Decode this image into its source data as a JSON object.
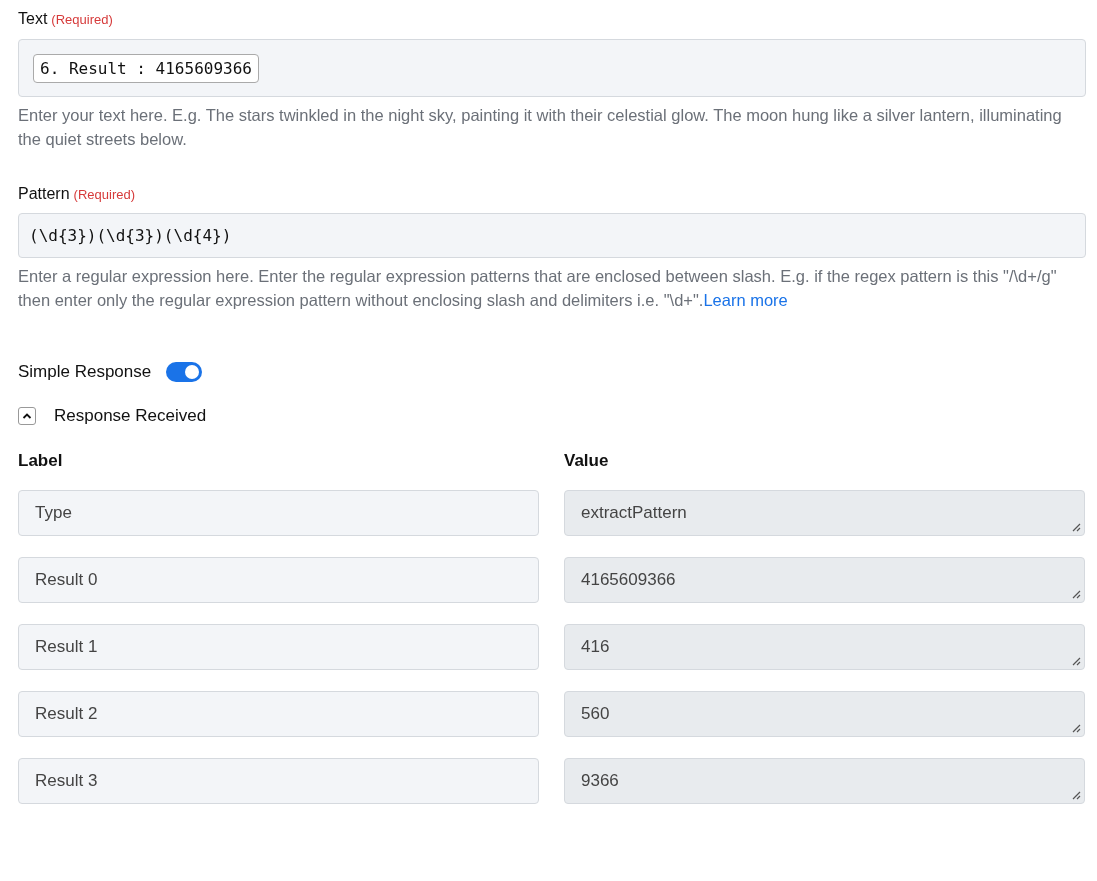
{
  "text_field": {
    "label": "Text",
    "required_note": "(Required)",
    "chip": "6. Result : 4165609366",
    "help": "Enter your text here. E.g. The stars twinkled in the night sky, painting it with their celestial glow. The moon hung like a silver lantern, illuminating the quiet streets below."
  },
  "pattern_field": {
    "label": "Pattern",
    "required_note": "(Required)",
    "value": "(\\d{3})(\\d{3})(\\d{4})",
    "help": "Enter a regular expression here. Enter the regular expression patterns that are enclosed between slash. E.g. if the regex pattern is this \"/\\d+/g\" then enter only the regular expression pattern without enclosing slash and delimiters i.e. \"\\d+\".",
    "help_link": "Learn more"
  },
  "simple_response": {
    "label": "Simple Response",
    "on": true
  },
  "response_section": {
    "title": "Response Received",
    "expanded": true
  },
  "table": {
    "columns": [
      "Label",
      "Value"
    ],
    "rows": [
      {
        "label": "Type",
        "value": "extractPattern"
      },
      {
        "label": "Result 0",
        "value": "4165609366"
      },
      {
        "label": "Result 1",
        "value": "416"
      },
      {
        "label": "Result 2",
        "value": "560"
      },
      {
        "label": "Result 3",
        "value": "9366"
      }
    ]
  }
}
